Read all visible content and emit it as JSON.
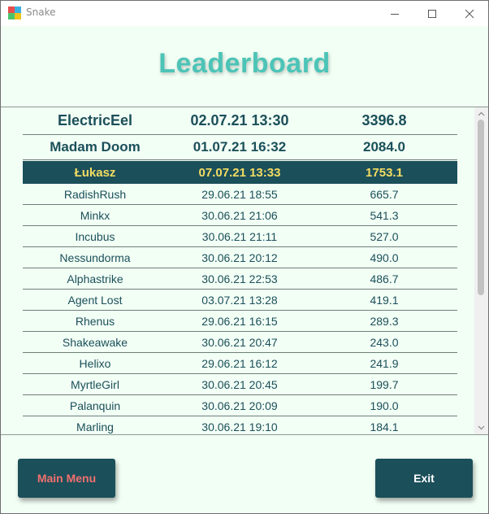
{
  "window": {
    "title": "Snake",
    "icon_colors": [
      "#e84d4d",
      "#3bb0e0",
      "#4cc46b",
      "#f0c419"
    ]
  },
  "header": {
    "title": "Leaderboard"
  },
  "leaderboard": {
    "top": [
      {
        "name": "ElectricEel",
        "date": "02.07.21 13:30",
        "score": "3396.8"
      },
      {
        "name": "Madam Doom",
        "date": "01.07.21 16:32",
        "score": "2084.0"
      }
    ],
    "highlighted": {
      "name": "Łukasz",
      "date": "07.07.21 13:33",
      "score": "1753.1"
    },
    "rows": [
      {
        "name": "RadishRush",
        "date": "29.06.21 18:55",
        "score": "665.7"
      },
      {
        "name": "Minkx",
        "date": "30.06.21 21:06",
        "score": "541.3"
      },
      {
        "name": "Incubus",
        "date": "30.06.21 21:11",
        "score": "527.0"
      },
      {
        "name": "Nessundorma",
        "date": "30.06.21 20:12",
        "score": "490.0"
      },
      {
        "name": "Alphastrike",
        "date": "30.06.21 22:53",
        "score": "486.7"
      },
      {
        "name": "Agent Lost",
        "date": "03.07.21 13:28",
        "score": "419.1"
      },
      {
        "name": "Rhenus",
        "date": "29.06.21 16:15",
        "score": "289.3"
      },
      {
        "name": "Shakeawake",
        "date": "30.06.21 20:47",
        "score": "243.0"
      },
      {
        "name": "Helixo",
        "date": "29.06.21 16:12",
        "score": "241.9"
      },
      {
        "name": "MyrtleGirl",
        "date": "30.06.21 20:45",
        "score": "199.7"
      },
      {
        "name": "Palanquin",
        "date": "30.06.21 20:09",
        "score": "190.0"
      },
      {
        "name": "Marling",
        "date": "30.06.21 19:10",
        "score": "184.1"
      }
    ]
  },
  "buttons": {
    "main_menu": "Main Menu",
    "exit": "Exit"
  },
  "colors": {
    "background": "#f2fff5",
    "accent_title": "#4cc4b7",
    "dark_teal": "#1b4f5a",
    "highlight_text": "#f5dc62",
    "main_menu_text": "#f2706e"
  }
}
